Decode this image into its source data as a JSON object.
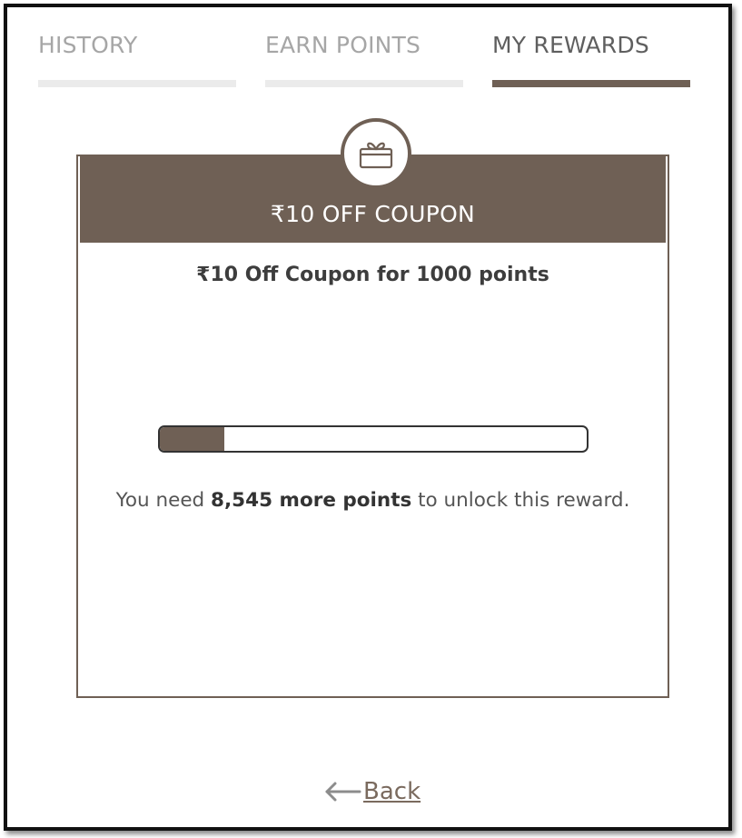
{
  "tabs": [
    {
      "label": "HISTORY",
      "active": false
    },
    {
      "label": "EARN POINTS",
      "active": false
    },
    {
      "label": "MY REWARDS",
      "active": true
    }
  ],
  "reward": {
    "icon": "gift-icon",
    "title": "₹10 OFF COUPON",
    "description": "₹10 Off Coupon for 1000 points",
    "progress_fraction": 0.15,
    "need_prefix": "You need ",
    "need_points": "8,545 more points",
    "need_suffix": " to unlock this reward."
  },
  "back": {
    "icon": "left-arrow-icon",
    "label": " Back"
  },
  "colors": {
    "brand": "#6f6055",
    "tab_inactive": "#a6a6a6",
    "tab_underline_inactive": "#ebebeb"
  }
}
